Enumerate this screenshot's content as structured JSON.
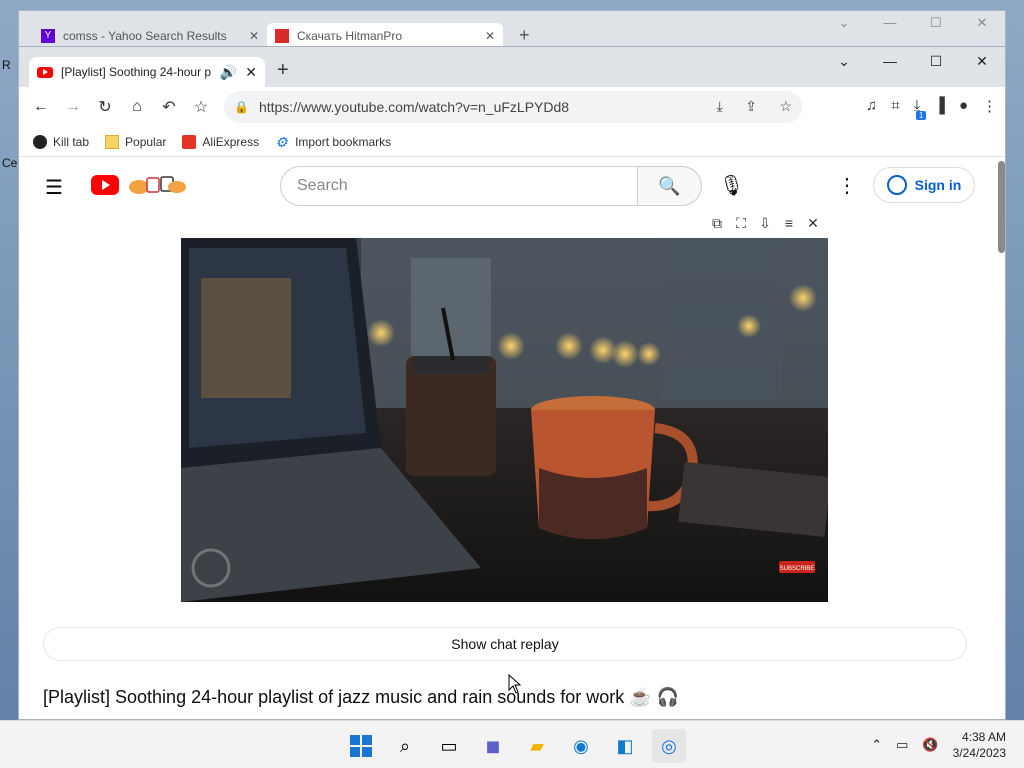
{
  "background_window": {
    "tabs": [
      {
        "label": "comss - Yahoo Search Results"
      },
      {
        "label": "Скачать HitmanPro"
      }
    ]
  },
  "browser": {
    "active_tab": {
      "label": "[Playlist] Soothing 24-hour p"
    },
    "url": "https://www.youtube.com/watch?v=n_uFzLPYDd8",
    "download_badge": "1",
    "bookmarks": [
      "Kill tab",
      "Popular",
      "AliExpress",
      "Import bookmarks"
    ]
  },
  "youtube": {
    "search_placeholder": "Search",
    "signin_label": "Sign in",
    "chat_replay_label": "Show chat replay",
    "video_title": "[Playlist] Soothing 24-hour playlist of jazz music and rain sounds for work ☕ 🎧",
    "video_overlay_text": "SUBSCRIBE"
  },
  "taskbar": {
    "time": "4:38 AM",
    "date": "3/24/2023"
  },
  "icons": [
    "menu-icon",
    "search-icon",
    "mic-icon",
    "more-icon",
    "back-icon",
    "forward-icon",
    "reload-icon",
    "home-icon",
    "star-icon"
  ],
  "colors": {
    "accent": "#065fd4",
    "youtube_red": "#ff0000",
    "taskbar_bg": "#f3f3f3"
  }
}
